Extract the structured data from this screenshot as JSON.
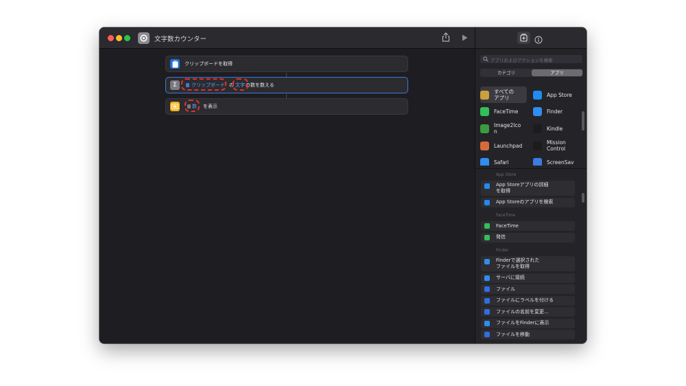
{
  "window": {
    "title": "文字数カウンター",
    "colors": {
      "close": "#ff5f57",
      "minimize": "#febc2e",
      "zoom": "#28c840",
      "accent": "#3d7bd6",
      "highlight": "#e0322f"
    }
  },
  "toolbar": {
    "app_icon": "shortcuts-icon",
    "share_icon": "share-icon",
    "run_icon": "play-icon",
    "add_library_icon": "library-add-icon",
    "info_icon": "info-icon"
  },
  "workflow": {
    "step1": {
      "icon": "clipboard-icon",
      "label": "クリップボードを取得"
    },
    "step2": {
      "icon": "sigma-icon",
      "token1": "クリップボード",
      "connector": "の",
      "token2": "文字",
      "suffix": "の数を数える"
    },
    "step3": {
      "icon": "show-result-icon",
      "token": "数",
      "suffix": "を表示"
    }
  },
  "sidebar": {
    "search_placeholder": "アプリおよびアクションを検索",
    "tabs": [
      "カテゴリ",
      "アプリ"
    ],
    "active_tab": "アプリ",
    "apps": [
      {
        "name": "すべての\nアプリ",
        "icon": "grid-icon",
        "color": "#c9a13c"
      },
      {
        "name": "App Store",
        "icon": "app-store-icon",
        "color": "#1f8bf3"
      },
      {
        "name": "FaceTime",
        "icon": "facetime-icon",
        "color": "#30c158"
      },
      {
        "name": "Finder",
        "icon": "finder-icon",
        "color": "#2f8ef0"
      },
      {
        "name": "Image2Ico\nn",
        "icon": "image2icon-icon",
        "color": "#3b9b3e"
      },
      {
        "name": "Kindle",
        "icon": "kindle-icon",
        "color": "#1c1c1c"
      },
      {
        "name": "Launchpad",
        "icon": "launchpad-icon",
        "color": "#d66a3c"
      },
      {
        "name": "Mission\nControl",
        "icon": "mission-control-icon",
        "color": "#1c1c1c"
      },
      {
        "name": "Safari",
        "icon": "safari-icon",
        "color": "#2f8ef0"
      },
      {
        "name": "ScreenSav",
        "icon": "screensaver-icon",
        "color": "#3b7de0"
      }
    ],
    "sections": [
      {
        "header": "App Store",
        "actions": [
          {
            "label": "App Storeアプリの詳細\nを取得",
            "icon": "app-store-icon",
            "color": "#1f8bf3"
          },
          {
            "label": "App Storeのアプリを検索",
            "icon": "app-store-icon",
            "color": "#1f8bf3"
          }
        ]
      },
      {
        "header": "FaceTime",
        "actions": [
          {
            "label": "FaceTime",
            "icon": "facetime-icon",
            "color": "#30c158"
          },
          {
            "label": "発信",
            "icon": "facetime-icon",
            "color": "#30c158"
          }
        ]
      },
      {
        "header": "Finder",
        "actions": [
          {
            "label": "Finderで選択された\nファイルを取得",
            "icon": "finder-icon",
            "color": "#2f8ef0"
          },
          {
            "label": "サーバに接続",
            "icon": "finder-icon",
            "color": "#2f8ef0"
          },
          {
            "label": "ファイル",
            "icon": "file-icon",
            "color": "#2f6fe0"
          },
          {
            "label": "ファイルにラベルを付ける",
            "icon": "tag-icon",
            "color": "#2f6fe0"
          },
          {
            "label": "ファイルの名前を変更...",
            "icon": "rename-icon",
            "color": "#2f6fe0"
          },
          {
            "label": "ファイルをFinderに表示",
            "icon": "finder-icon",
            "color": "#2f8ef0"
          },
          {
            "label": "ファイルを移動",
            "icon": "move-icon",
            "color": "#2f6fe0"
          }
        ]
      }
    ]
  }
}
